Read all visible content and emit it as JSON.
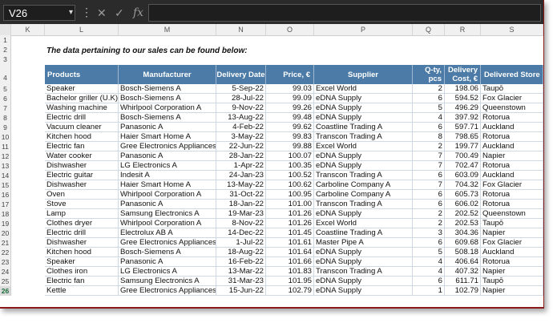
{
  "formula_bar": {
    "name_box": "V26",
    "fx_label": "fx"
  },
  "columns": [
    "K",
    "L",
    "M",
    "N",
    "O",
    "P",
    "Q",
    "R",
    "S"
  ],
  "rows": [
    "1",
    "2",
    "3",
    "4",
    "5",
    "6",
    "7",
    "8",
    "9",
    "10",
    "11",
    "12",
    "13",
    "14",
    "15",
    "16",
    "17",
    "18",
    "19",
    "20",
    "21",
    "22",
    "23",
    "24",
    "25",
    "26"
  ],
  "selected_row": "26",
  "intro_text": "The data pertaining to our sales can be found below:",
  "table": {
    "headers": {
      "products": "Products",
      "manufacturer": "Manufacturer",
      "delivery_date": "Delivery Date",
      "price": "Price, €",
      "supplier": "Supplier",
      "qty": "Q-ty, pcs",
      "delivery_cost": "Delivery Cost, €",
      "delivered_store": "Delivered Store"
    },
    "rows": [
      [
        "Speaker",
        "Bosch-Siemens A",
        "5-Sep-22",
        "99.03",
        "Excel World",
        "2",
        "198.06",
        "Taupō"
      ],
      [
        "Bachelor griller (U.K)",
        "Bosch-Siemens A",
        "28-Jul-22",
        "99.09",
        "eDNA Supply",
        "6",
        "594.52",
        "Fox Glacier"
      ],
      [
        "Washing machine",
        "Whirlpool Corporation A",
        "9-Nov-22",
        "99.26",
        "eDNA Supply",
        "5",
        "496.29",
        "Queenstown"
      ],
      [
        "Electric drill",
        "Bosch-Siemens A",
        "13-Aug-22",
        "99.48",
        "eDNA Supply",
        "4",
        "397.92",
        "Rotorua"
      ],
      [
        "Vacuum cleaner",
        "Panasonic A",
        "4-Feb-22",
        "99.62",
        "Coastline Trading A",
        "6",
        "597.71",
        "Auckland"
      ],
      [
        "Kitchen hood",
        "Haier Smart Home A",
        "3-May-22",
        "99.83",
        "Transcon Trading A",
        "8",
        "798.65",
        "Rotorua"
      ],
      [
        "Electric fan",
        "Gree Electronics Appliances A",
        "22-Jun-22",
        "99.88",
        "Excel World",
        "2",
        "199.77",
        "Auckland"
      ],
      [
        "Water cooker",
        "Panasonic A",
        "28-Jan-22",
        "100.07",
        "eDNA Supply",
        "7",
        "700.49",
        "Napier"
      ],
      [
        "Dishwasher",
        "LG Electronics A",
        "1-Apr-22",
        "100.35",
        "eDNA Supply",
        "7",
        "702.47",
        "Rotorua"
      ],
      [
        "Electric guitar",
        "Indesit A",
        "24-Jan-23",
        "100.52",
        "Transcon Trading A",
        "6",
        "603.09",
        "Auckland"
      ],
      [
        "Dishwasher",
        "Haier Smart Home A",
        "13-May-22",
        "100.62",
        "Carboline Company A",
        "7",
        "704.32",
        "Fox Glacier"
      ],
      [
        "Oven",
        "Whirlpool Corporation A",
        "31-Oct-22",
        "100.95",
        "Carboline Company A",
        "6",
        "605.73",
        "Rotorua"
      ],
      [
        "Stove",
        "Panasonic A",
        "18-Jan-22",
        "101.00",
        "Transcon Trading A",
        "6",
        "606.02",
        "Rotorua"
      ],
      [
        "Lamp",
        "Samsung Electronics A",
        "19-Mar-23",
        "101.26",
        "eDNA Supply",
        "2",
        "202.52",
        "Queenstown"
      ],
      [
        "Clothes dryer",
        "Whirlpool Corporation A",
        "8-Nov-22",
        "101.26",
        "Excel World",
        "2",
        "202.53",
        "Taupō"
      ],
      [
        "Electric drill",
        "Electrolux AB A",
        "14-Dec-22",
        "101.45",
        "Coastline Trading A",
        "3",
        "304.36",
        "Napier"
      ],
      [
        "Dishwasher",
        "Gree Electronics Appliances A",
        "1-Jul-22",
        "101.61",
        "Master Pipe A",
        "6",
        "609.68",
        "Fox Glacier"
      ],
      [
        "Kitchen hood",
        "Bosch-Siemens A",
        "18-Aug-22",
        "101.64",
        "eDNA Supply",
        "5",
        "508.18",
        "Auckland"
      ],
      [
        "Speaker",
        "Panasonic A",
        "16-Feb-22",
        "101.66",
        "eDNA Supply",
        "4",
        "406.64",
        "Rotorua"
      ],
      [
        "Clothes iron",
        "LG Electronics A",
        "13-Mar-22",
        "101.83",
        "Transcon Trading A",
        "4",
        "407.32",
        "Napier"
      ],
      [
        "Electric fan",
        "Samsung Electronics A",
        "31-Mar-23",
        "101.95",
        "eDNA Supply",
        "6",
        "611.71",
        "Taupō"
      ],
      [
        "Kettle",
        "Gree Electronics Appliances A",
        "15-Jun-22",
        "102.79",
        "eDNA Supply",
        "1",
        "102.79",
        "Napier"
      ]
    ]
  },
  "colors": {
    "header_bg": "#4b7ba6",
    "header_text": "#ffffff",
    "formula_bar_bg": "#2b2b2b",
    "torn_edge": "#8b1a1a"
  }
}
